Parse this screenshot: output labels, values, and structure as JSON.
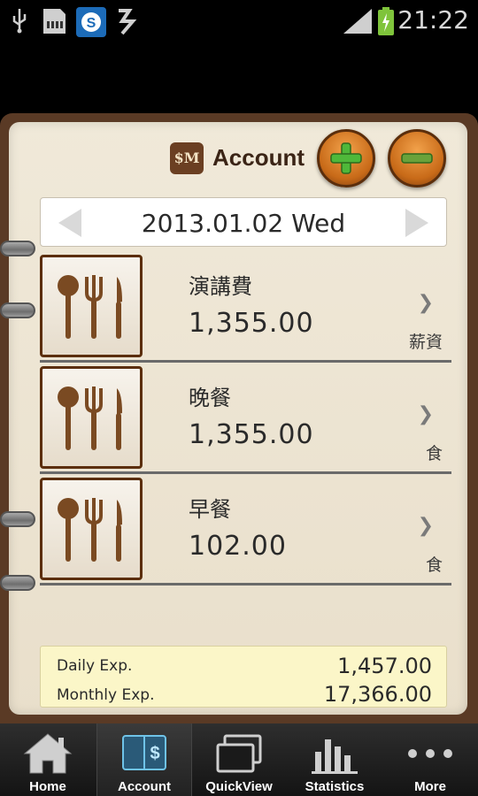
{
  "status_bar": {
    "time": "21:22",
    "icons": [
      "usb-icon",
      "sd-card-icon",
      "skype-icon",
      "sync-icon",
      "signal-icon",
      "battery-charging-icon"
    ]
  },
  "header": {
    "logo_text": "$M",
    "title": "Account",
    "add_icon": "plus-icon",
    "remove_icon": "minus-icon"
  },
  "date_bar": {
    "date": "2013.01.02 Wed"
  },
  "entries": [
    {
      "icon": "utensils-icon",
      "name": "演講費",
      "amount": "1,355.00",
      "category": "薪資"
    },
    {
      "icon": "utensils-icon",
      "name": "晚餐",
      "amount": "1,355.00",
      "category": "食"
    },
    {
      "icon": "utensils-icon",
      "name": "早餐",
      "amount": "102.00",
      "category": "食"
    }
  ],
  "totals": {
    "daily_label": "Daily Exp.",
    "daily_value": "1,457.00",
    "monthly_label": "Monthly Exp.",
    "monthly_value": "17,366.00"
  },
  "nav": [
    {
      "label": "Home",
      "icon": "home-icon",
      "active": false
    },
    {
      "label": "Account",
      "icon": "account-book-icon",
      "active": true
    },
    {
      "label": "QuickView",
      "icon": "windows-icon",
      "active": false
    },
    {
      "label": "Statistics",
      "icon": "bar-chart-icon",
      "active": false
    },
    {
      "label": "More",
      "icon": "more-dots-icon",
      "active": false
    }
  ],
  "colors": {
    "accent_orange": "#d97a22",
    "plus_green": "#4fb83a",
    "minus_green": "#6aa23a",
    "wood_brown": "#5a3a25",
    "paper": "#efe7d6",
    "totals_bg": "#fbf6c8"
  }
}
